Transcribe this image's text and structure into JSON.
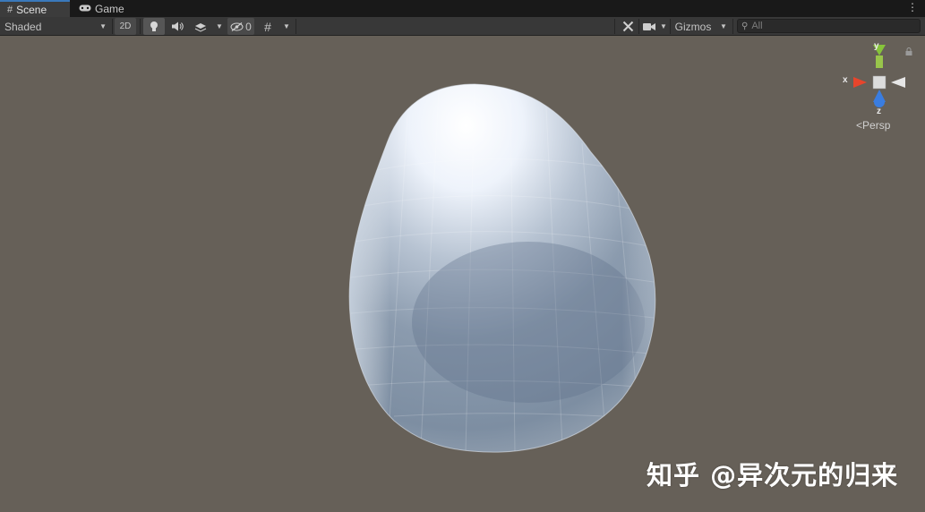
{
  "tabs": [
    {
      "label": "Scene",
      "icon": "grid-icon",
      "active": true
    },
    {
      "label": "Game",
      "icon": "gamepad-icon",
      "active": false
    }
  ],
  "toolbar": {
    "draw_mode": "Shaded",
    "mode_2d": "2D",
    "hidden_count": "0",
    "gizmos_label": "Gizmos",
    "search_placeholder": "All"
  },
  "scene_gizmo": {
    "axis_y": "y",
    "axis_x": "x",
    "axis_z": "z",
    "projection": "Persp",
    "colors": {
      "x": "#e8452c",
      "y": "#86c43a",
      "z": "#3a7de0"
    }
  },
  "watermark": "知乎 @异次元的归来"
}
